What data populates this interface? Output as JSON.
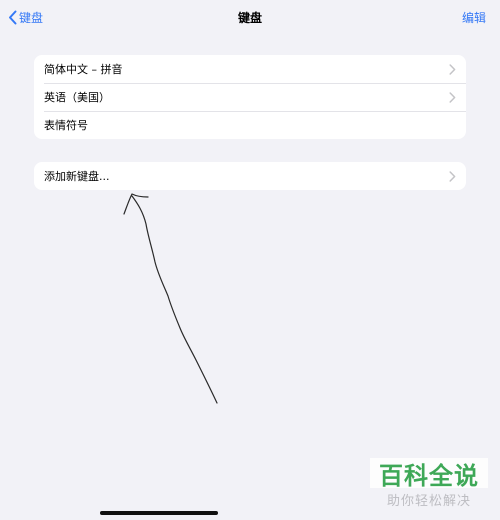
{
  "navbar": {
    "back_label": "键盘",
    "title": "键盘",
    "edit_label": "编辑"
  },
  "keyboards": [
    {
      "label": "简体中文 – 拼音",
      "has_chevron": true
    },
    {
      "label": "英语（美国）",
      "has_chevron": true
    },
    {
      "label": "表情符号",
      "has_chevron": false
    }
  ],
  "add_keyboard": {
    "label": "添加新键盘..."
  },
  "watermark": {
    "brand": "百科全说",
    "tagline": "助你轻松解决"
  },
  "colors": {
    "accent": "#3478f6",
    "background": "#f2f2f7",
    "cell_background": "#ffffff",
    "separator": "#e3e3e8",
    "chevron": "#c4c4c7",
    "watermark_green": "#1f9c3c"
  },
  "icons": {
    "back": "chevron-left-icon",
    "row": "chevron-right-icon"
  }
}
